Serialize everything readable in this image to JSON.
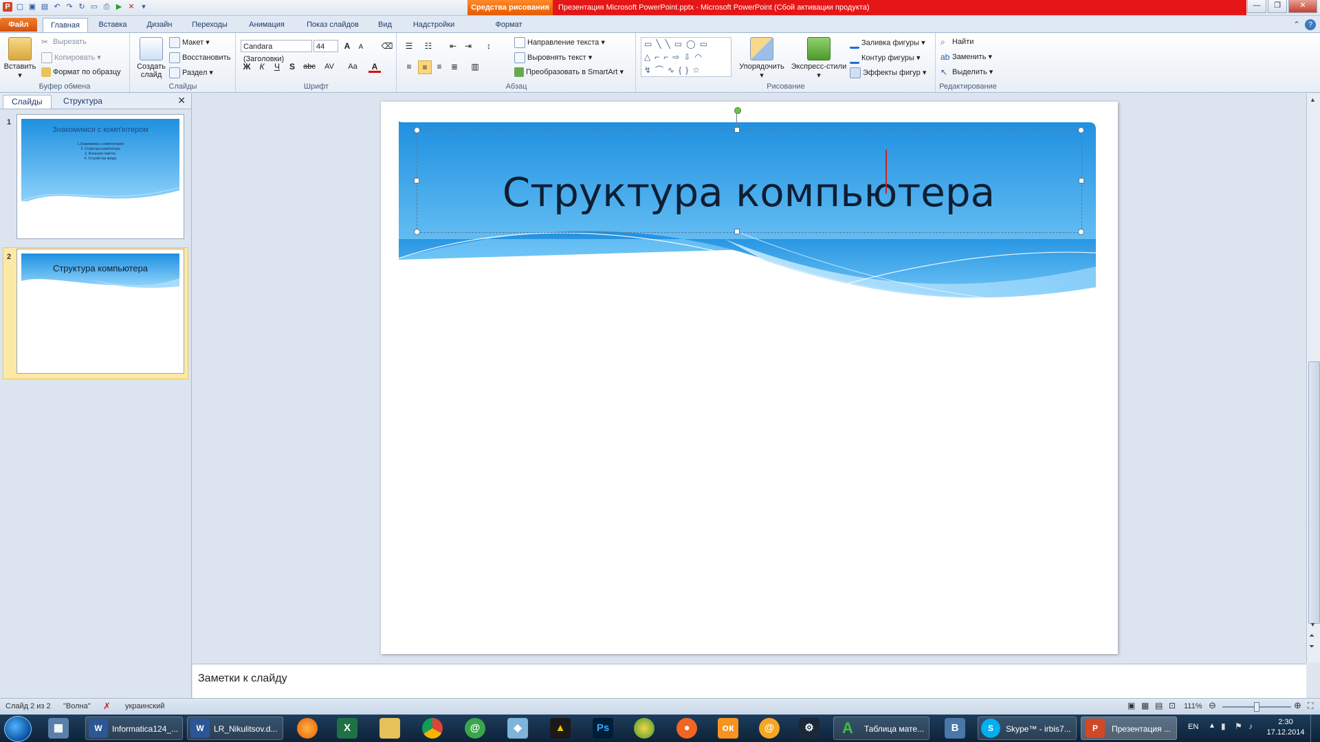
{
  "titlebar": {
    "context_tab": "Средства рисования",
    "title": "Презентация Microsoft PowerPoint.pptx  -  Microsoft PowerPoint (Сбой активации продукта)",
    "qat_icons": [
      "save-icon",
      "undo-icon",
      "redo-icon",
      "new-icon",
      "open-icon",
      "print-icon",
      "slideshow-icon"
    ]
  },
  "tabs": {
    "file": "Файл",
    "home": "Главная",
    "insert": "Вставка",
    "design": "Дизайн",
    "transitions": "Переходы",
    "animations": "Анимация",
    "slideshow": "Показ слайдов",
    "view": "Вид",
    "addins": "Надстройки",
    "format": "Формат"
  },
  "ribbon": {
    "clipboard": {
      "label": "Буфер обмена",
      "paste": "Вставить",
      "cut": "Вырезать",
      "copy": "Копировать",
      "format_painter": "Формат по образцу"
    },
    "slides": {
      "label": "Слайды",
      "new_slide": "Создать слайд",
      "layout": "Макет",
      "reset": "Восстановить",
      "section": "Раздел"
    },
    "font": {
      "label": "Шрифт",
      "font_name": "Candara (Заголовки)",
      "font_size": "44",
      "bold": "Ж",
      "italic": "К",
      "underline": "Ч",
      "shadow": "S",
      "strike": "abc",
      "spacing": "AV",
      "case": "Aa",
      "color": "A"
    },
    "paragraph": {
      "label": "Абзац",
      "text_direction": "Направление текста",
      "align_text": "Выровнять текст",
      "smartart": "Преобразовать в SmartArt"
    },
    "drawing": {
      "label": "Рисование",
      "arrange": "Упорядочить",
      "quick_styles": "Экспресс-стили",
      "shape_fill": "Заливка фигуры",
      "shape_outline": "Контур фигуры",
      "shape_effects": "Эффекты фигур"
    },
    "editing": {
      "label": "Редактирование",
      "find": "Найти",
      "replace": "Заменить",
      "select": "Выделить"
    }
  },
  "left_panel": {
    "tab_slides": "Слайды",
    "tab_outline": "Структура",
    "thumbnails": [
      {
        "number": "1",
        "title": "Знакомимся с комп'ютером",
        "bullets": [
          "1.Знакомимся  з комп'ютером",
          "2. Структура комп'ютера",
          "3. Внешняя пам'ять",
          "4. Устройства ввода"
        ]
      },
      {
        "number": "2",
        "title": "Структура компьютера"
      }
    ]
  },
  "slide": {
    "title": "Структура компьютера"
  },
  "notes": {
    "placeholder": "Заметки к слайду"
  },
  "statusbar": {
    "slide_info": "Слайд 2 из 2",
    "theme": "\"Волна\"",
    "language": "украинский",
    "zoom": "111%"
  },
  "taskbar": {
    "items": [
      {
        "label": "Informatica124_...",
        "icon": "word-icon"
      },
      {
        "label": "LR_Nikulitsov.d...",
        "icon": "word-icon"
      },
      {
        "label": "Таблица мате...",
        "icon": "app-icon"
      },
      {
        "label": "Skype™ - irbis7...",
        "icon": "skype-icon"
      },
      {
        "label": "Презентация ...",
        "icon": "powerpoint-icon"
      }
    ],
    "lang": "EN",
    "time": "2:30",
    "date": "17.12.2014"
  },
  "colors": {
    "accent_red": "#e51616",
    "context_orange": "#e55a00",
    "slide_blue_top": "#1f90e0",
    "slide_blue_bottom": "#8cd1fa"
  }
}
